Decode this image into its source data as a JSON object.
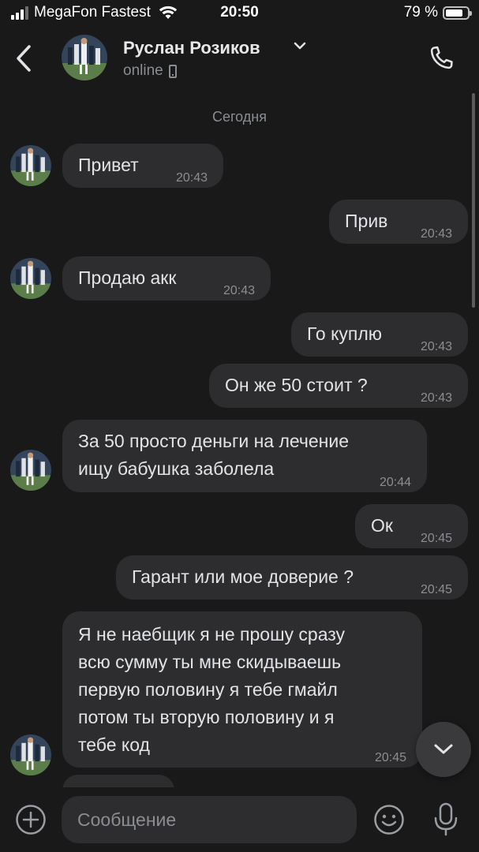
{
  "status_bar": {
    "carrier": "MegaFon Fastest",
    "time": "20:50",
    "battery": "79 %",
    "battery_level": 0.79
  },
  "header": {
    "name": "Руслан Розиков",
    "status": "online",
    "back_icon": "chevron-left-icon",
    "call_icon": "phone-icon"
  },
  "chat": {
    "date_separator": "Сегодня",
    "messages": [
      {
        "direction": "incoming",
        "text": "Привет",
        "time": "20:43"
      },
      {
        "direction": "outgoing",
        "text": "Прив",
        "time": "20:43"
      },
      {
        "direction": "incoming",
        "text": "Продаю акк",
        "time": "20:43"
      },
      {
        "direction": "outgoing",
        "text": "Го куплю",
        "time": "20:43"
      },
      {
        "direction": "outgoing",
        "text": "Он же 50 стоит ?",
        "time": "20:43"
      },
      {
        "direction": "incoming",
        "lines": [
          "За 50 просто деньги на лечение",
          "ищу бабушка заболела"
        ],
        "time": "20:44"
      },
      {
        "direction": "outgoing",
        "text": "Ок",
        "time": "20:45"
      },
      {
        "direction": "outgoing",
        "text": "Гарант или мое доверие ?",
        "time": "20:45"
      },
      {
        "direction": "incoming",
        "lines": [
          "Я не наебщик я не прошу сразу",
          "всю сумму ты мне скидываешь",
          "первую половину я тебе гмайл",
          "потом ты вторую половину и я",
          "тебе код"
        ],
        "time": "20:45"
      }
    ]
  },
  "composer": {
    "placeholder": "Сообщение",
    "value": ""
  },
  "colors": {
    "background": "#19191a",
    "bubble": "#2d2d2f",
    "text": "#e1e3e6",
    "secondary_text": "#8a8d91"
  }
}
